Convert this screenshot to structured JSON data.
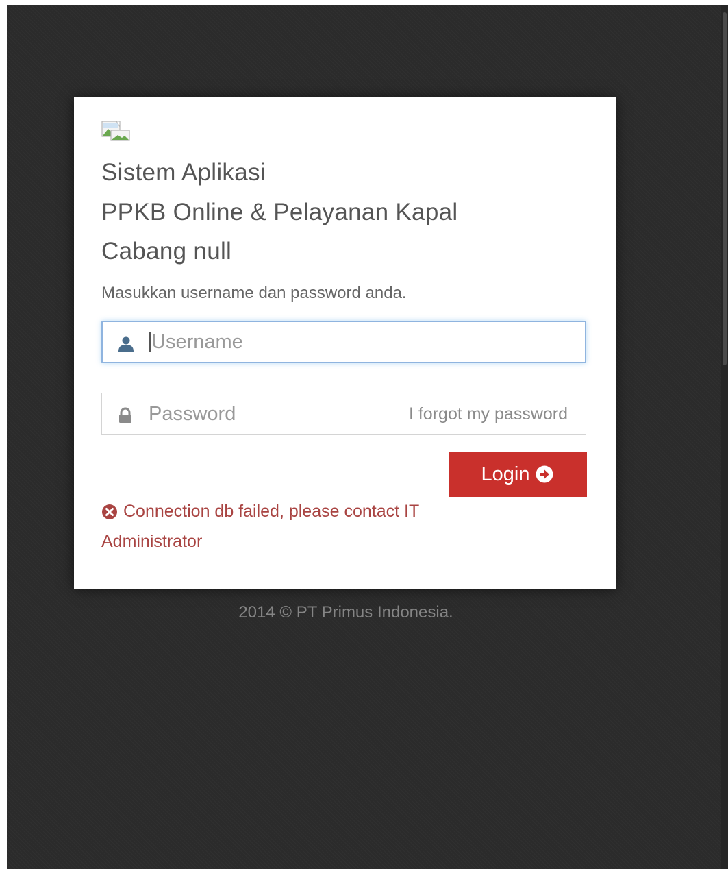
{
  "login_box": {
    "title_lines": [
      "Sistem Aplikasi",
      "PPKB Online & Pelayanan Kapal",
      "Cabang null"
    ],
    "instruction": "Masukkan username dan password anda.",
    "username": {
      "placeholder": "Username",
      "value": "",
      "icon": "user-icon"
    },
    "password": {
      "placeholder": "Password",
      "value": "",
      "icon": "lock-icon"
    },
    "forgot_link": "I forgot my password",
    "login_button": {
      "label": "Login",
      "icon": "arrow-circle-right-icon"
    },
    "error": {
      "icon": "times-circle-icon",
      "lines": [
        "Connection db failed, please contact IT",
        "Administrator"
      ]
    }
  },
  "footer": {
    "text": "2014 © PT Primus Indonesia."
  },
  "colors": {
    "background": "#2b2b2b",
    "card": "#ffffff",
    "login_button": "#c9302c",
    "error_text": "#a94442",
    "focus_border": "#8fb4df"
  }
}
